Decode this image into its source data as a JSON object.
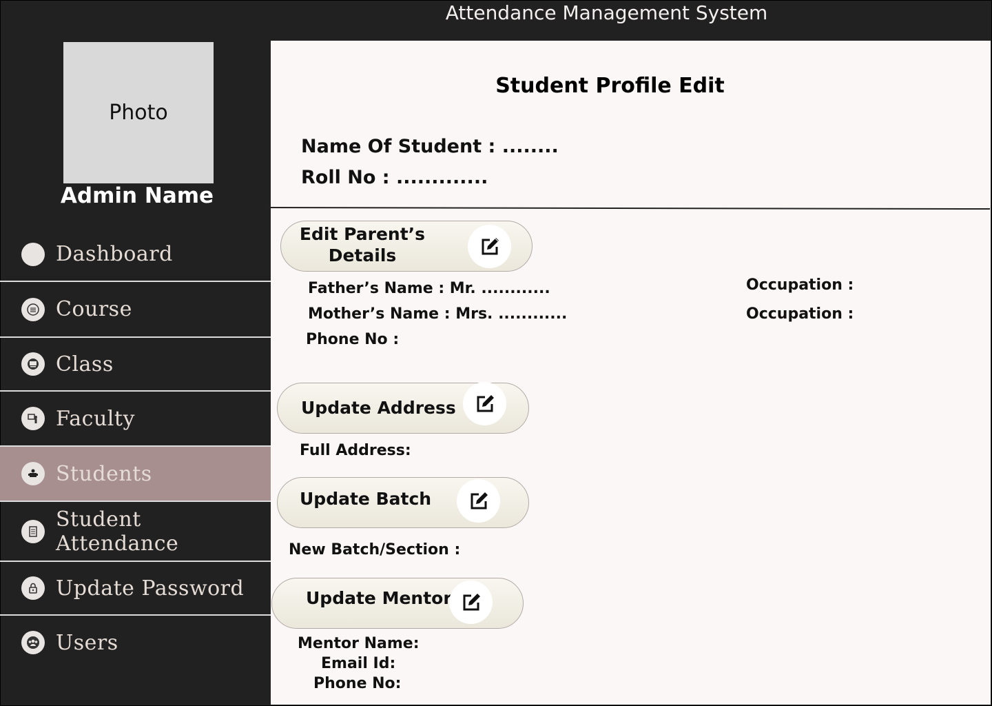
{
  "app": {
    "title": "Attendance Management System"
  },
  "sidebar": {
    "photo_label": "Photo",
    "admin_name": "Admin Name",
    "items": [
      {
        "label": "Dashboard",
        "icon": "dashboard-icon"
      },
      {
        "label": "Course",
        "icon": "course-icon"
      },
      {
        "label": "Class",
        "icon": "class-icon"
      },
      {
        "label": "Faculty",
        "icon": "faculty-icon"
      },
      {
        "label": "Students",
        "icon": "students-icon",
        "active": true
      },
      {
        "label": "Student Attendance",
        "icon": "attendance-icon"
      },
      {
        "label": "Update Password",
        "icon": "lock-icon"
      },
      {
        "label": "Users",
        "icon": "users-icon"
      }
    ]
  },
  "main": {
    "page_title": "Student Profile Edit",
    "student_name_line": "Name Of Student : ........",
    "roll_no_line": "Roll No : .............",
    "parents": {
      "button_line1": "Edit Parent’s",
      "button_line2": "Details",
      "father": "Father’s Name : Mr.  ............",
      "mother": "Mother’s Name : Mrs.  ............",
      "phone": "Phone No :",
      "father_occupation": "Occupation :",
      "mother_occupation": "Occupation :"
    },
    "address": {
      "button": "Update Address",
      "field": "Full Address:"
    },
    "batch": {
      "button": "Update Batch",
      "field": "New Batch/Section :"
    },
    "mentor": {
      "button": "Update Mentor",
      "name": "Mentor Name:",
      "email": "Email Id:",
      "phone": "Phone No:"
    }
  },
  "colors": {
    "background": "#222121",
    "content_bg": "#fbf7f6",
    "active_nav": "#a88f8f",
    "photo_bg": "#d9d9d9"
  }
}
